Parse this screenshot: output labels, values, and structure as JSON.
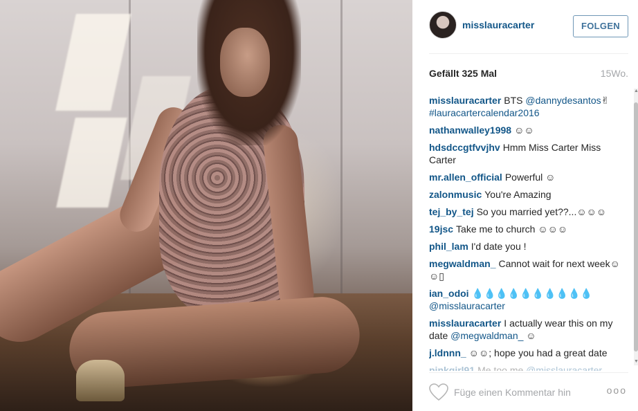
{
  "post": {
    "username": "misslauracarter",
    "follow_label": "FOLGEN",
    "likes": "Gefällt 325 Mal",
    "time_ago": "15Wo."
  },
  "comments": [
    {
      "author": "misslauracarter",
      "parts": [
        {
          "t": "text",
          "v": "BTS "
        },
        {
          "t": "mention",
          "v": "@dannydesantos"
        },
        {
          "t": "text",
          "v": "✌ "
        },
        {
          "t": "hashtag",
          "v": "#lauracartercalendar2016"
        }
      ]
    },
    {
      "author": "nathanwalley1998",
      "parts": [
        {
          "t": "text",
          "v": "☺☺"
        }
      ]
    },
    {
      "author": "hdsdccgtfvvjhv",
      "parts": [
        {
          "t": "text",
          "v": "Hmm Miss Carter Miss Carter"
        }
      ]
    },
    {
      "author": "mr.allen_official",
      "parts": [
        {
          "t": "text",
          "v": "Powerful ☺"
        }
      ]
    },
    {
      "author": "zalonmusic",
      "parts": [
        {
          "t": "text",
          "v": "You're Amazing"
        }
      ]
    },
    {
      "author": "tej_by_tej",
      "parts": [
        {
          "t": "text",
          "v": "So you married yet??...☺☺☺"
        }
      ]
    },
    {
      "author": "19jsc",
      "parts": [
        {
          "t": "text",
          "v": "Take me to church ☺☺☺"
        }
      ]
    },
    {
      "author": "phil_lam",
      "parts": [
        {
          "t": "text",
          "v": "I'd date you !"
        }
      ]
    },
    {
      "author": "megwaldman_",
      "parts": [
        {
          "t": "text",
          "v": "Cannot wait for next week☺☺▯"
        }
      ]
    },
    {
      "author": "ian_odoi",
      "parts": [
        {
          "t": "text",
          "v": "💧💧💧💧💧💧💧💧💧💧 "
        },
        {
          "t": "mention",
          "v": "@misslauracarter"
        }
      ]
    },
    {
      "author": "misslauracarter",
      "parts": [
        {
          "t": "text",
          "v": "I actually wear this on my date "
        },
        {
          "t": "mention",
          "v": "@megwaldman_"
        },
        {
          "t": "text",
          "v": " ☺"
        }
      ]
    },
    {
      "author": "j.ldnnn_",
      "parts": [
        {
          "t": "text",
          "v": "☺☺; hope you had a great date"
        }
      ]
    },
    {
      "author": "pinkgirl91",
      "parts": [
        {
          "t": "text",
          "v": "Me too me "
        },
        {
          "t": "mention",
          "v": "@misslauracarter"
        }
      ],
      "faded": true
    }
  ],
  "footer": {
    "comment_placeholder": "Füge einen Kommentar hin",
    "more_icon": "ooo"
  },
  "icons": {
    "heart": "heart-icon",
    "more": "more-options-icon",
    "avatar": "avatar"
  },
  "colors": {
    "link": "#125688",
    "follow_text": "#3f729b",
    "muted": "#a5a7aa"
  }
}
